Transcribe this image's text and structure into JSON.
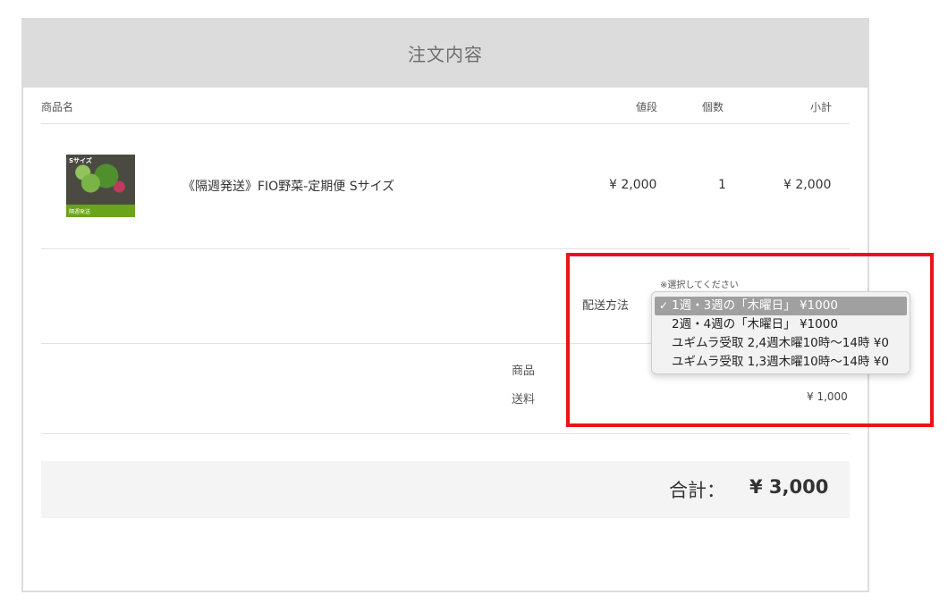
{
  "header": {
    "title": "注文内容"
  },
  "table": {
    "columns": {
      "product": "商品名",
      "price": "値段",
      "qty": "個数",
      "subtotal": "小計"
    },
    "items": [
      {
        "thumb_tag": "Sサイズ",
        "thumb_band": "隔週発送",
        "name": "《隔週発送》FIO野菜-定期便 Sサイズ",
        "price": "¥ 2,000",
        "qty": "1",
        "subtotal": "¥ 2,000"
      }
    ]
  },
  "shipping": {
    "label": "配送方法",
    "note": "※選択してください",
    "options": [
      "1週・3週の「木曜日」 ¥1000",
      "2週・4週の「木曜日」 ¥1000",
      "ユギムラ受取 2,4週木曜10時〜14時 ¥0",
      "ユギムラ受取 1,3週木曜10時〜14時 ¥0"
    ],
    "selected_index": 0,
    "check_glyph": "✓"
  },
  "summary": {
    "goods_label": "商品",
    "shipping_label": "送料",
    "shipping_value": "¥ 1,000"
  },
  "total": {
    "label": "合計：",
    "value": "¥ 3,000"
  },
  "colors": {
    "header_bg": "#dcdcdc",
    "highlight": "#e8141b",
    "total_bg": "#f4f4f4"
  }
}
